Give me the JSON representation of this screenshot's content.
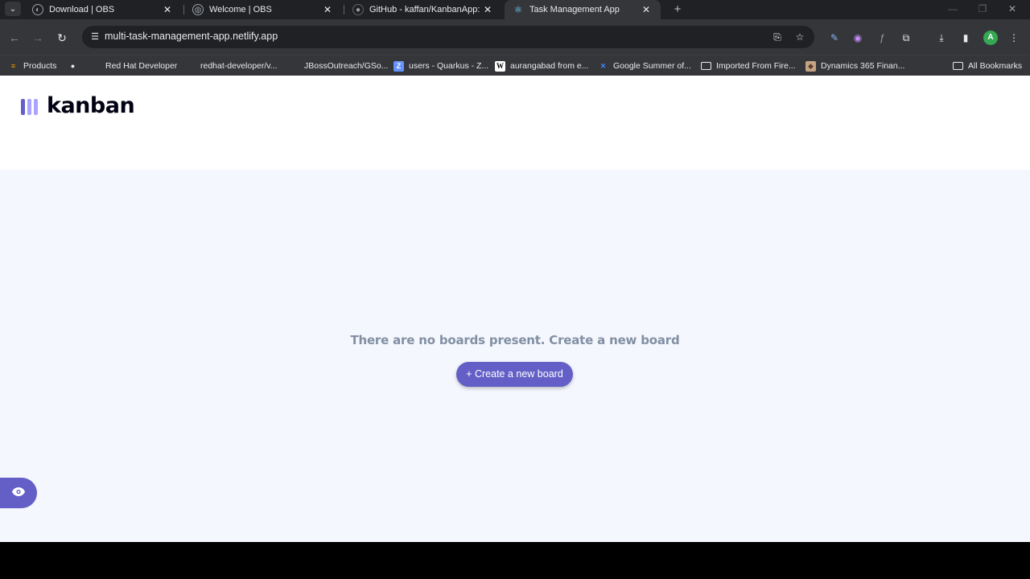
{
  "browser": {
    "tabs": [
      {
        "title": "Download | OBS",
        "icon": "obs-icon"
      },
      {
        "title": "Welcome | OBS",
        "icon": "globe-icon"
      },
      {
        "title": "GitHub - kaffan/KanbanApp: Th",
        "icon": "github-icon"
      },
      {
        "title": "Task Management App",
        "icon": "react-icon",
        "active": true
      }
    ],
    "url": "multi-task-management-app.netlify.app",
    "profile_initial": "A",
    "bookmarks": [
      {
        "label": "Products",
        "icon": "products-icon"
      },
      {
        "label": "",
        "icon": "bookmark-dot-icon"
      },
      {
        "label": "Red Hat Developer",
        "icon": "redhat-icon"
      },
      {
        "label": "redhat-developer/v...",
        "icon": "github-icon"
      },
      {
        "label": "JBossOutreach/GSo...",
        "icon": "github-icon"
      },
      {
        "label": "users - Quarkus - Z...",
        "icon": "zulip-icon"
      },
      {
        "label": "aurangabad from e...",
        "icon": "wikipedia-icon"
      },
      {
        "label": "Google Summer of...",
        "icon": "gsoc-icon"
      },
      {
        "label": "Imported From Fire...",
        "icon": "folder-icon"
      },
      {
        "label": "Dynamics 365 Finan...",
        "icon": "dynamics-icon"
      }
    ],
    "all_bookmarks": "All Bookmarks"
  },
  "app": {
    "logo_text": "kanban",
    "logo_colors": [
      "#635fc7",
      "#a8a4ff",
      "#a8a4ff"
    ],
    "empty_message": "There are no boards present. Create a new board",
    "create_button": "+ Create a new board",
    "accent": "#635fc7"
  }
}
